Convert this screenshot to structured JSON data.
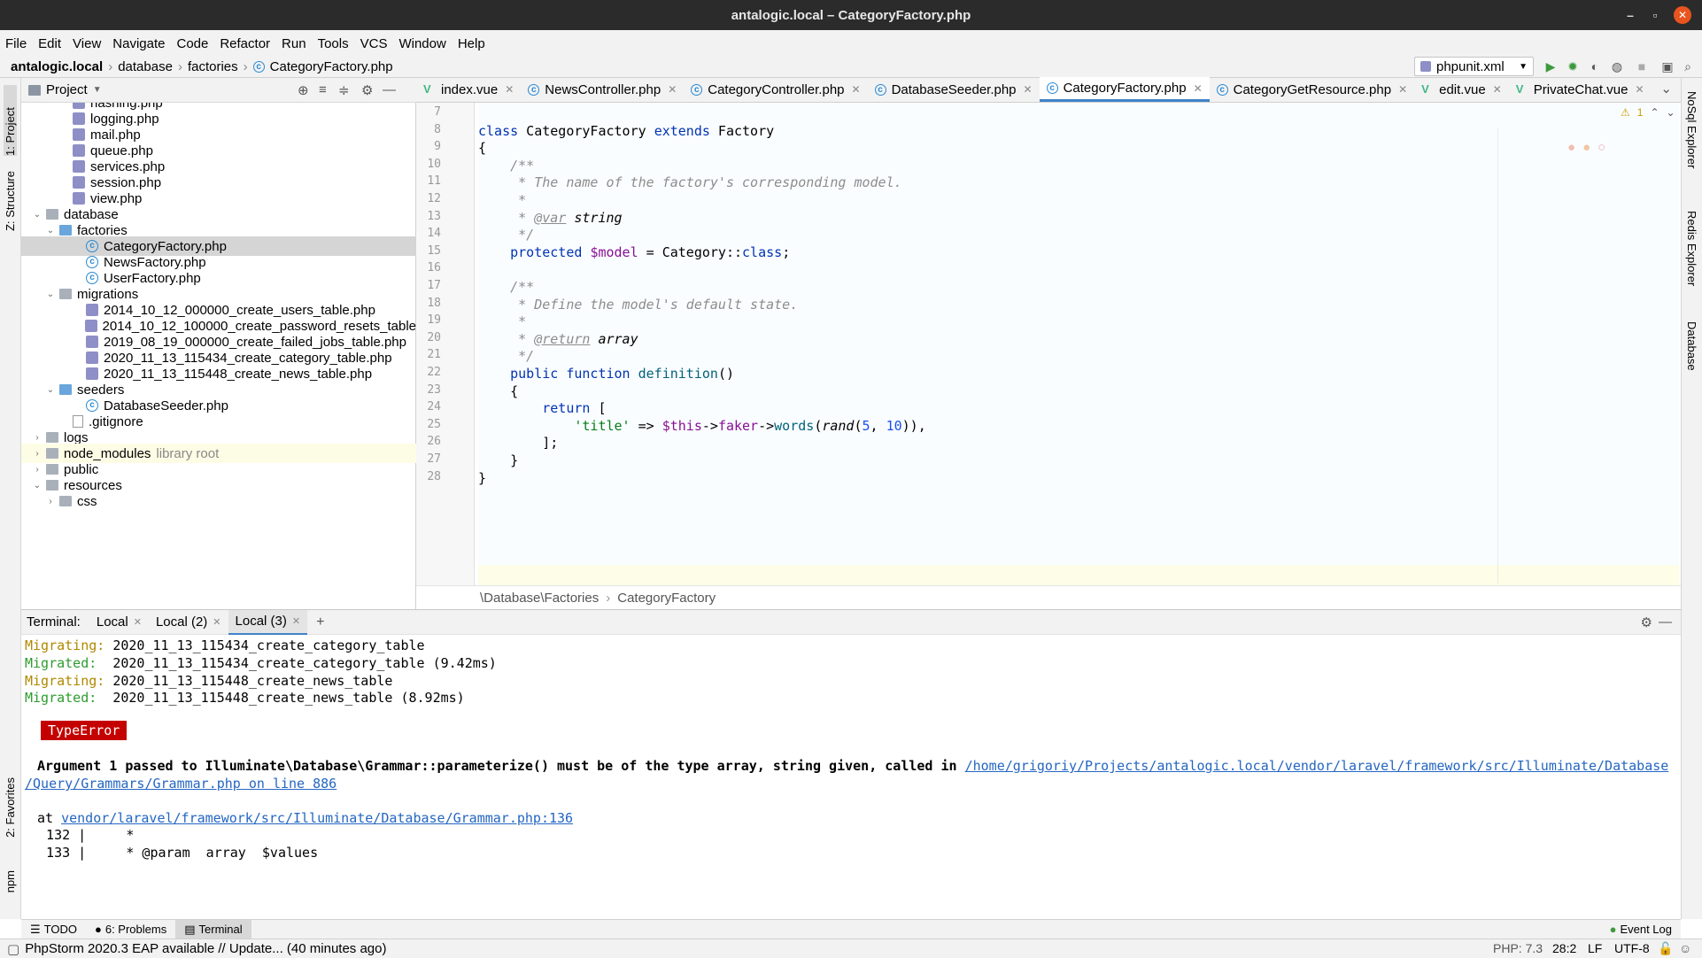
{
  "window": {
    "title": "antalogic.local – CategoryFactory.php"
  },
  "menu": [
    "File",
    "Edit",
    "View",
    "Navigate",
    "Code",
    "Refactor",
    "Run",
    "Tools",
    "VCS",
    "Window",
    "Help"
  ],
  "nav": {
    "project": "antalogic.local",
    "path1": "database",
    "path2": "factories",
    "file": "CategoryFactory.php",
    "run_config": "phpunit.xml"
  },
  "left_strip": {
    "project": "1: Project",
    "structure": "Z: Structure",
    "favorites": "2: Favorites",
    "npm": "npm"
  },
  "right_strip": {
    "nosql": "NoSql Explorer",
    "redis": "Redis Explorer",
    "database": "Database"
  },
  "project_panel": {
    "title": "Project",
    "rows": [
      {
        "label": "hashing.php",
        "icon": "php",
        "indent": 3
      },
      {
        "label": "logging.php",
        "icon": "php",
        "indent": 3
      },
      {
        "label": "mail.php",
        "icon": "php",
        "indent": 3
      },
      {
        "label": "queue.php",
        "icon": "php",
        "indent": 3
      },
      {
        "label": "services.php",
        "icon": "php",
        "indent": 3
      },
      {
        "label": "session.php",
        "icon": "php",
        "indent": 3
      },
      {
        "label": "view.php",
        "icon": "php",
        "indent": 3
      },
      {
        "label": "database",
        "icon": "folder",
        "indent": 1,
        "arrow": "open"
      },
      {
        "label": "factories",
        "icon": "folder-blue",
        "indent": 2,
        "arrow": "open"
      },
      {
        "label": "CategoryFactory.php",
        "icon": "class",
        "indent": 4,
        "selected": true
      },
      {
        "label": "NewsFactory.php",
        "icon": "class",
        "indent": 4
      },
      {
        "label": "UserFactory.php",
        "icon": "class",
        "indent": 4
      },
      {
        "label": "migrations",
        "icon": "folder",
        "indent": 2,
        "arrow": "open"
      },
      {
        "label": "2014_10_12_000000_create_users_table.php",
        "icon": "php",
        "indent": 4
      },
      {
        "label": "2014_10_12_100000_create_password_resets_table",
        "icon": "php",
        "indent": 4
      },
      {
        "label": "2019_08_19_000000_create_failed_jobs_table.php",
        "icon": "php",
        "indent": 4
      },
      {
        "label": "2020_11_13_115434_create_category_table.php",
        "icon": "php",
        "indent": 4
      },
      {
        "label": "2020_11_13_115448_create_news_table.php",
        "icon": "php",
        "indent": 4
      },
      {
        "label": "seeders",
        "icon": "folder-blue",
        "indent": 2,
        "arrow": "open"
      },
      {
        "label": "DatabaseSeeder.php",
        "icon": "class",
        "indent": 4
      },
      {
        "label": ".gitignore",
        "icon": "file",
        "indent": 3
      },
      {
        "label": "logs",
        "icon": "folder",
        "indent": 1,
        "arrow": "closed"
      },
      {
        "label": "node_modules",
        "icon": "folder",
        "indent": 1,
        "arrow": "closed",
        "note": "library root",
        "highlight": true
      },
      {
        "label": "public",
        "icon": "folder",
        "indent": 1,
        "arrow": "closed"
      },
      {
        "label": "resources",
        "icon": "folder",
        "indent": 1,
        "arrow": "open"
      },
      {
        "label": "css",
        "icon": "folder",
        "indent": 2,
        "arrow": "closed"
      }
    ]
  },
  "editor_tabs": [
    {
      "label": "index.vue",
      "icon": "vue"
    },
    {
      "label": "NewsController.php",
      "icon": "class"
    },
    {
      "label": "CategoryController.php",
      "icon": "class"
    },
    {
      "label": "DatabaseSeeder.php",
      "icon": "class"
    },
    {
      "label": "CategoryFactory.php",
      "icon": "class",
      "active": true
    },
    {
      "label": "CategoryGetResource.php",
      "icon": "class"
    },
    {
      "label": "edit.vue",
      "icon": "vue"
    },
    {
      "label": "PrivateChat.vue",
      "icon": "vue"
    }
  ],
  "editor": {
    "line_numbers": [
      "7",
      "8",
      "9",
      "10",
      "11",
      "12",
      "13",
      "14",
      "15",
      "16",
      "17",
      "18",
      "19",
      "20",
      "21",
      "22",
      "23",
      "24",
      "25",
      "26",
      "27",
      "28"
    ],
    "warnings": "1",
    "lines": [
      "",
      "class CategoryFactory extends Factory",
      "{",
      "    /**",
      "     * The name of the factory's corresponding model.",
      "     *",
      "     * @var string",
      "     */",
      "    protected $model = Category::class;",
      "",
      "    /**",
      "     * Define the model's default state.",
      "     *",
      "     * @return array",
      "     */",
      "    public function definition()",
      "    {",
      "        return [",
      "            'title' => $this->faker->words(rand(5, 10)),",
      "        ];",
      "    }",
      "}"
    ],
    "breadcrumb": [
      "\\Database\\Factories",
      "CategoryFactory"
    ]
  },
  "terminal": {
    "label": "Terminal:",
    "tabs": [
      "Local",
      "Local (2)",
      "Local (3)"
    ],
    "output": {
      "l1a": "Migrating:",
      "l1b": " 2020_11_13_115434_create_category_table",
      "l2a": "Migrated:",
      "l2b": "  2020_11_13_115434_create_category_table (9.42ms)",
      "l3a": "Migrating:",
      "l3b": " 2020_11_13_115448_create_news_table",
      "l4a": "Migrated:",
      "l4b": "  2020_11_13_115448_create_news_table (8.92ms)",
      "error_badge": "TypeError",
      "msg": "Argument 1 passed to Illuminate\\Database\\Grammar::parameterize() must be of the type array, string given, called in ",
      "msg_link1": "/home/grigoriy/Projects/antalogic.local/vendor/laravel/framework/src/Illuminate/Database",
      "msg_link2": "/Query/Grammars/Grammar.php on line 886",
      "at": "at ",
      "at_link": "vendor/laravel/framework/src/Illuminate/Database/Grammar.php:136",
      "src1": "  132 |     *",
      "src2": "  133 |     * @param  array  $values"
    }
  },
  "bottom_tabs": [
    "TODO",
    "6: Problems",
    "Terminal"
  ],
  "event_log": "Event Log",
  "status": {
    "message": "PhpStorm 2020.3 EAP available // Update... (40 minutes ago)",
    "php": "PHP: 7.3",
    "pos": "28:2",
    "eol": "LF",
    "enc": "UTF-8"
  }
}
